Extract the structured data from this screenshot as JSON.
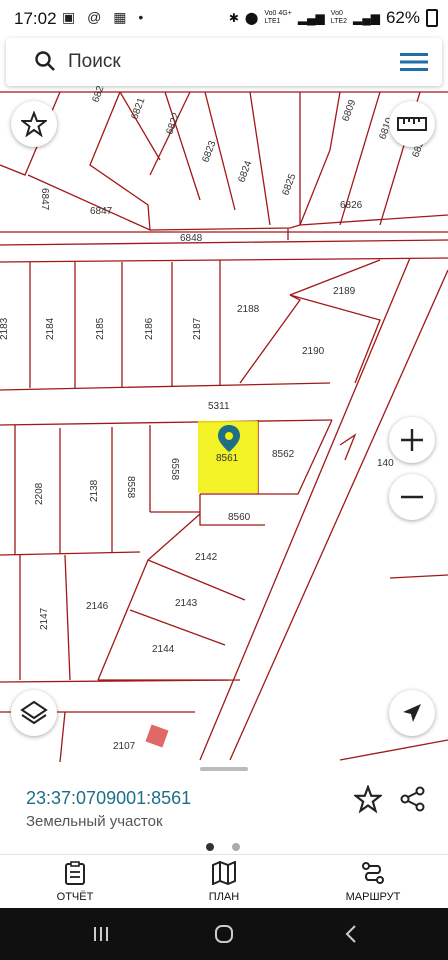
{
  "status": {
    "time": "17:02",
    "left_icons": "▣ @ ▦ •",
    "signal1": "Vo0 4G+\nLTE1",
    "signal2": "Vo0\nLTE2",
    "battery": "62%"
  },
  "search": {
    "placeholder": "Поиск"
  },
  "map": {
    "parcel_labels": {
      "p6820": "6820",
      "p6821": "6821",
      "p6822": "6822",
      "p6823": "6823",
      "p6824": "6824",
      "p6825": "6825",
      "p6826": "6826",
      "p6809": "6809",
      "p6810": "6810",
      "p6847": "6847",
      "p6847b": "6847",
      "p6848": "6848",
      "p2183": "2183",
      "p2184": "2184",
      "p2185": "2185",
      "p2186": "2186",
      "p2187": "2187",
      "p2188": "2188",
      "p2189": "2189",
      "p2190": "2190",
      "p5311": "5311",
      "p8561": "8561",
      "p8562": "8562",
      "p140": "140",
      "p2208": "2208",
      "p2138": "2138",
      "p8558": "8558",
      "p6558": "6558",
      "p8560": "8560",
      "p2142": "2142",
      "p2143": "2143",
      "p2144": "2144",
      "p2146": "2146",
      "p2147": "2147",
      "p2107": "2107"
    },
    "selected_color": "#f0f000",
    "line_color": "#a01818",
    "marker_color": "#1e6f86"
  },
  "sheet": {
    "cadastral_number": "23:37:0709001:8561",
    "parcel_type": "Земельный участок"
  },
  "nav": {
    "report": "ОТЧЁТ",
    "plan": "ПЛАН",
    "route": "МАРШРУТ"
  }
}
